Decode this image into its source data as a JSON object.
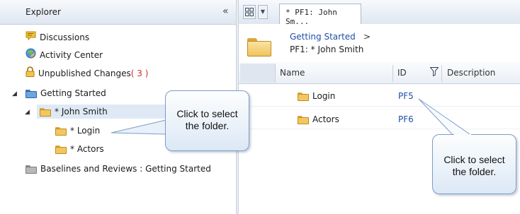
{
  "explorer": {
    "title": "Explorer",
    "collapse_glyph": "«",
    "items": [
      {
        "label": "Discussions",
        "icon": "discussions-icon"
      },
      {
        "label": "Activity Center",
        "icon": "activity-center-icon"
      },
      {
        "label": "Unpublished Changes",
        "count": "( 3 )",
        "icon": "lock-icon"
      }
    ],
    "tree": {
      "root": "Getting Started",
      "child": "* John Smith",
      "grandchildren": [
        "* Login",
        "* Actors"
      ],
      "baseline": "Baselines and Reviews : Getting Started"
    }
  },
  "tabs": {
    "doc_tab_label": "* PF1: John Sm..."
  },
  "breadcrumb": {
    "link": "Getting Started",
    "separator": ">",
    "current": "PF1: * John Smith"
  },
  "grid": {
    "columns": {
      "name": "Name",
      "id": "ID",
      "description": "Description"
    },
    "rows": [
      {
        "name": "Login",
        "id": "PF5",
        "description": ""
      },
      {
        "name": "Actors",
        "id": "PF6",
        "description": ""
      }
    ]
  },
  "callouts": {
    "left": [
      "Click to select",
      "the folder."
    ],
    "right": [
      "Click to select",
      "the folder."
    ]
  },
  "colors": {
    "link": "#1d4fa8",
    "count": "#d52b2b",
    "callout_border": "#7e9dc4"
  }
}
